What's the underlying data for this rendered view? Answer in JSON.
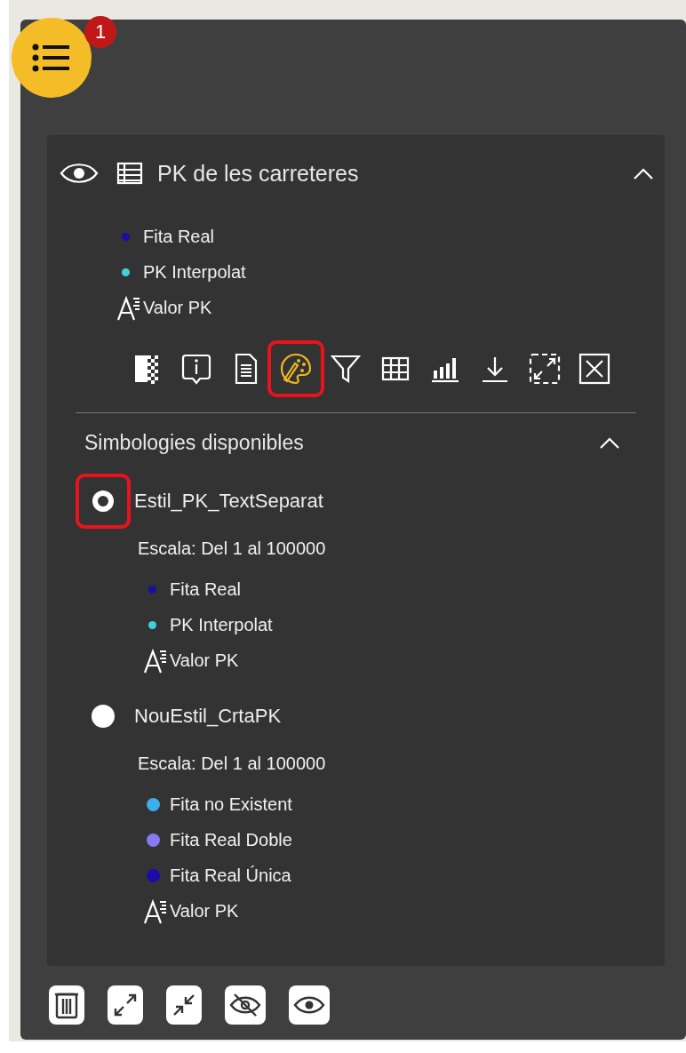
{
  "menu_button": {
    "badge": "1"
  },
  "layer": {
    "visible": true,
    "title": "PK de les carreteres",
    "expanded": true,
    "legend": [
      {
        "kind": "point",
        "label": "Fita Real",
        "color": "#1a0ea0"
      },
      {
        "kind": "point",
        "label": "PK Interpolat",
        "color": "#3fd3d6"
      },
      {
        "kind": "text",
        "label": "Valor PK"
      }
    ],
    "tools": [
      {
        "kind": "transparency",
        "selected": false,
        "highlighted": false
      },
      {
        "kind": "info",
        "selected": false,
        "highlighted": false
      },
      {
        "kind": "document",
        "selected": false,
        "highlighted": false
      },
      {
        "kind": "style",
        "selected": true,
        "highlighted": true
      },
      {
        "kind": "filter",
        "selected": false,
        "highlighted": false
      },
      {
        "kind": "table",
        "selected": false,
        "highlighted": false
      },
      {
        "kind": "chart",
        "selected": false,
        "highlighted": false
      },
      {
        "kind": "download",
        "selected": false,
        "highlighted": false
      },
      {
        "kind": "zoom-extent",
        "selected": false,
        "highlighted": false
      },
      {
        "kind": "remove",
        "selected": false,
        "highlighted": false
      }
    ],
    "symbologies": {
      "title": "Simbologies disponibles",
      "expanded": true,
      "styles": [
        {
          "name": "Estil_PK_TextSeparat",
          "selected": true,
          "highlighted": true,
          "scale": "Escala: Del 1 al 100000",
          "legend": [
            {
              "kind": "point",
              "label": "Fita Real",
              "color": "#1a0ea0"
            },
            {
              "kind": "point",
              "label": "PK Interpolat",
              "color": "#3fd3d6"
            },
            {
              "kind": "text",
              "label": "Valor PK"
            }
          ]
        },
        {
          "name": "NouEstil_CrtaPK",
          "selected": false,
          "highlighted": false,
          "scale": "Escala: Del 1 al 100000",
          "legend": [
            {
              "kind": "marker",
              "label": "Fita no Existent",
              "color": "#3daee9"
            },
            {
              "kind": "marker",
              "label": "Fita Real Doble",
              "color": "#8679f5"
            },
            {
              "kind": "marker",
              "label": "Fita Real Única",
              "color": "#1d0aa8"
            },
            {
              "kind": "text",
              "label": "Valor PK"
            }
          ]
        }
      ]
    }
  },
  "footer_tools": [
    {
      "kind": "delete"
    },
    {
      "kind": "expand"
    },
    {
      "kind": "collapse"
    },
    {
      "kind": "hide"
    },
    {
      "kind": "show"
    }
  ]
}
